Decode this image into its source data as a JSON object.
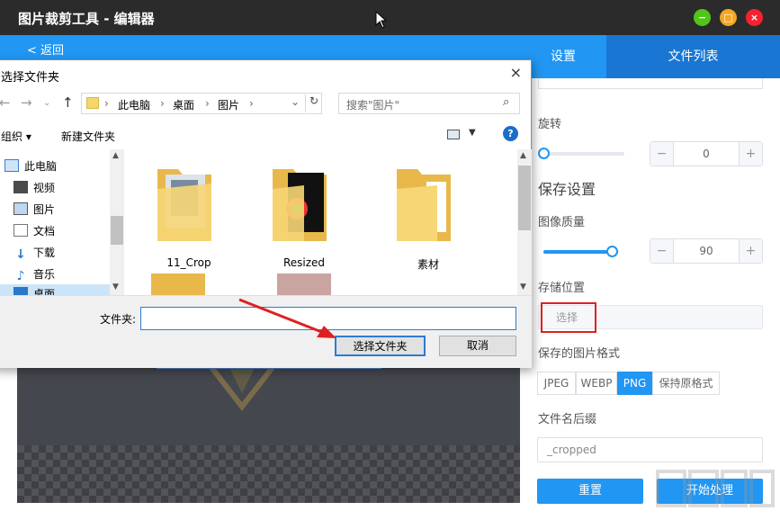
{
  "app": {
    "title": "图片裁剪工具 - 编辑器",
    "back_label": "< 返回"
  },
  "window_buttons": {
    "minimize": "−",
    "maximize": "□",
    "close": "×",
    "minimize_color": "#52c41a",
    "maximize_color": "#f5a623",
    "close_color": "#f5222d"
  },
  "tabs": {
    "settings": "设置",
    "file_list": "文件列表"
  },
  "settings": {
    "rotate_label": "旋转",
    "rotate_minus": "−",
    "rotate_value": "0",
    "rotate_plus": "+",
    "rotate_level": 0,
    "save_section": "保存设置",
    "quality_label": "图像质量",
    "quality_minus": "−",
    "quality_value": "90",
    "quality_plus": "+",
    "quality_level": 0.9,
    "location_label": "存储位置",
    "location_button": "选择",
    "format_label": "保存的图片格式",
    "formats": [
      "JPEG",
      "WEBP",
      "PNG",
      "保持原格式"
    ],
    "selected_format": "PNG",
    "suffix_label": "文件名后缀",
    "suffix_value": "_cropped",
    "reset_button": "重置",
    "start_button": "开始处理"
  },
  "dialog": {
    "title": "选择文件夹",
    "close": "×",
    "breadcrumb": [
      "此电脑",
      "桌面",
      "图片"
    ],
    "search_placeholder": "搜索\"图片\"",
    "organize": "组织 ▾",
    "new_folder": "新建文件夹",
    "help": "?",
    "nav_items": [
      {
        "label": "此电脑",
        "icon": "computer-icon"
      },
      {
        "label": "视频",
        "icon": "video-icon"
      },
      {
        "label": "图片",
        "icon": "picture-icon"
      },
      {
        "label": "文档",
        "icon": "document-icon"
      },
      {
        "label": "下载",
        "icon": "download-icon"
      },
      {
        "label": "音乐",
        "icon": "music-icon"
      },
      {
        "label": "桌面",
        "icon": "desktop-icon"
      }
    ],
    "folders": [
      "11_Crop",
      "Resized",
      "素材"
    ],
    "folder_label": "文件夹:",
    "folder_value": "",
    "select_button": "选择文件夹",
    "cancel_button": "取消"
  },
  "colors": {
    "accent": "#2196f3",
    "highlight": "#e02020"
  }
}
